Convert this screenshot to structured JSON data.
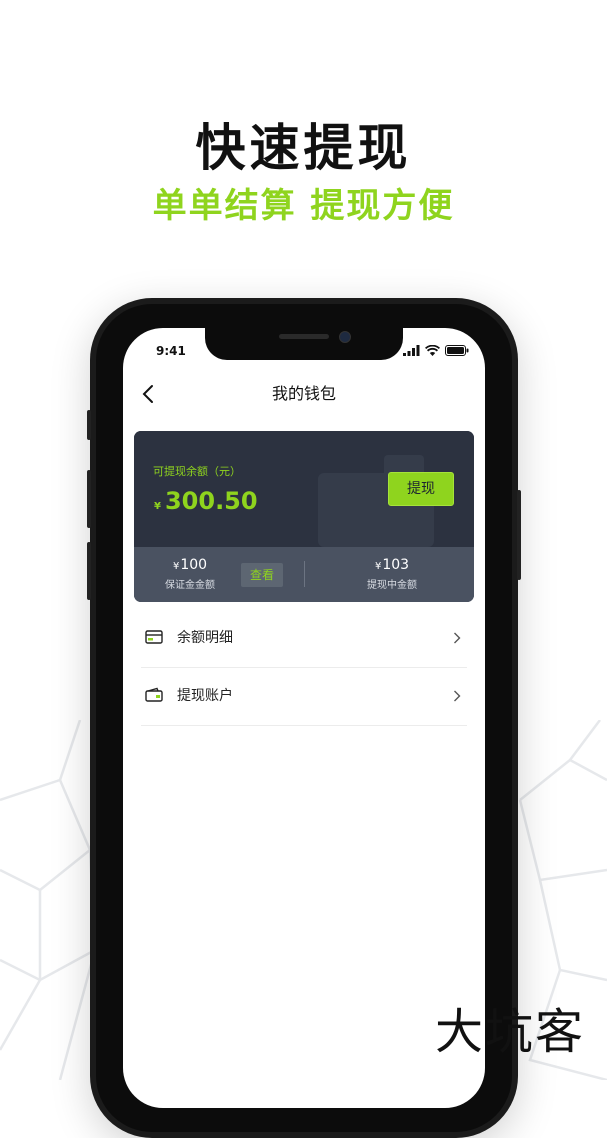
{
  "promo": {
    "headline": "快速提现",
    "subheadline": "单单结算 提现方便",
    "brand": "大坑客"
  },
  "status_bar": {
    "time": "9:41"
  },
  "nav": {
    "title": "我的钱包",
    "back_icon": "chevron-left-icon"
  },
  "wallet": {
    "available_label": "可提现余额（元）",
    "currency_symbol": "¥",
    "available_amount": "300.50",
    "withdraw_label": "提现",
    "deposit": {
      "value": "100",
      "label": "保证金金额",
      "view_label": "查看"
    },
    "pending": {
      "value": "103",
      "label": "提现中金额"
    }
  },
  "menu": [
    {
      "label": "余额明细",
      "icon": "balance-detail-icon"
    },
    {
      "label": "提现账户",
      "icon": "wallet-icon"
    }
  ],
  "colors": {
    "accent": "#8fd41e",
    "card_dark": "#2c3240",
    "card_light": "#4a5261"
  }
}
